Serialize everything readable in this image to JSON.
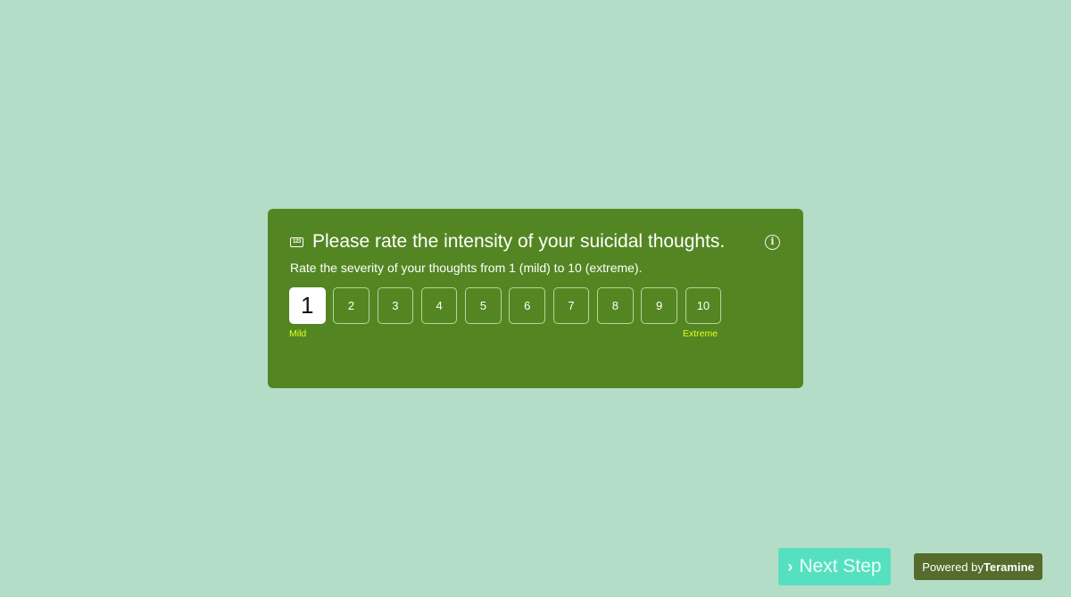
{
  "question": {
    "icon": "number-input-icon",
    "icon_text": "123",
    "title": "Please rate the intensity of your suicidal thoughts.",
    "subtitle": "Rate the severity of your thoughts from 1 (mild) to 10 (extreme).",
    "info_icon": "info-icon",
    "info_glyph": "i"
  },
  "scale": {
    "options": [
      "1",
      "2",
      "3",
      "4",
      "5",
      "6",
      "7",
      "8",
      "9",
      "10"
    ],
    "selected": "1",
    "min_label": "Mild",
    "max_label": "Extreme"
  },
  "footer": {
    "next_chevron": "›",
    "next_label": "Next Step",
    "powered_prefix": "Powered by",
    "powered_brand": "Teramine"
  },
  "colors": {
    "background": "#b4ddc7",
    "card": "#538622",
    "scale_label": "#e4ff1a",
    "next_button": "#56e0c0",
    "powered_badge": "#566b2c"
  }
}
